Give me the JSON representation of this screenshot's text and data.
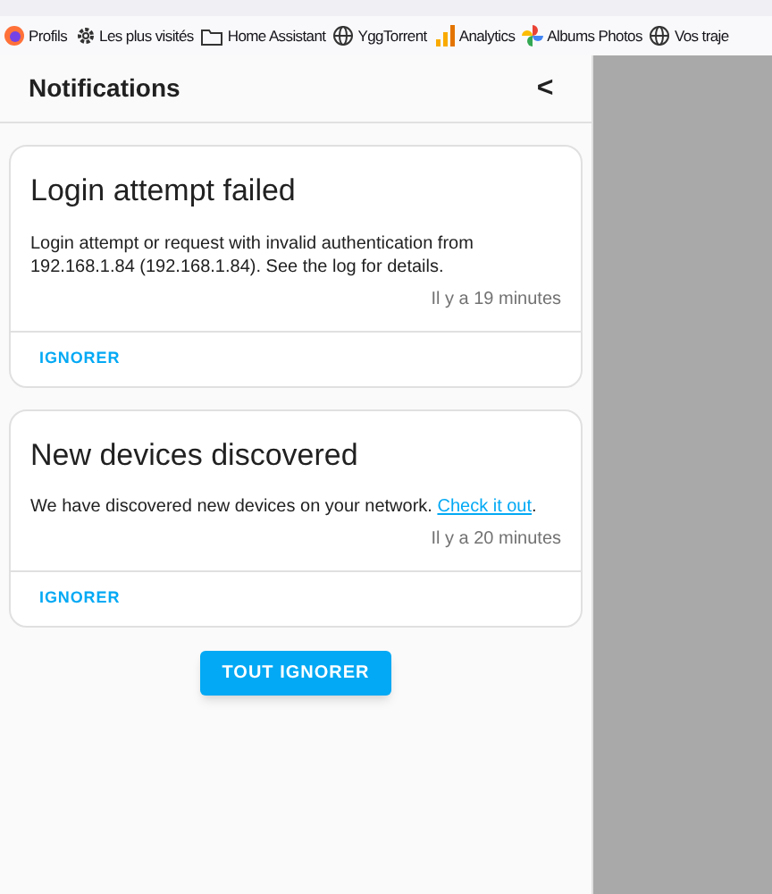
{
  "bookmarks": [
    {
      "label": "Profils",
      "kind": "firefox"
    },
    {
      "label": "Les plus visités",
      "kind": "gear"
    },
    {
      "label": "Home Assistant",
      "kind": "folder"
    },
    {
      "label": "YggTorrent",
      "kind": "globe"
    },
    {
      "label": "Analytics",
      "kind": "bars"
    },
    {
      "label": "Albums Photos",
      "kind": "pinwheel"
    },
    {
      "label": "Vos traje",
      "kind": "globe"
    }
  ],
  "panel": {
    "title": "Notifications",
    "close": "<"
  },
  "notifications": [
    {
      "title": "Login attempt failed",
      "message": "Login attempt or request with invalid authentication from 192.168.1.84 (192.168.1.84). See the log for details.",
      "time": "Il y a 19 minutes",
      "action": "IGNORER"
    },
    {
      "title": "New devices discovered",
      "message": "We have discovered new devices on your network. ",
      "link": "Check it out",
      "message_end": ".",
      "time": "Il y a 20 minutes",
      "action": "IGNORER"
    }
  ],
  "dismiss_all": "TOUT IGNORER"
}
